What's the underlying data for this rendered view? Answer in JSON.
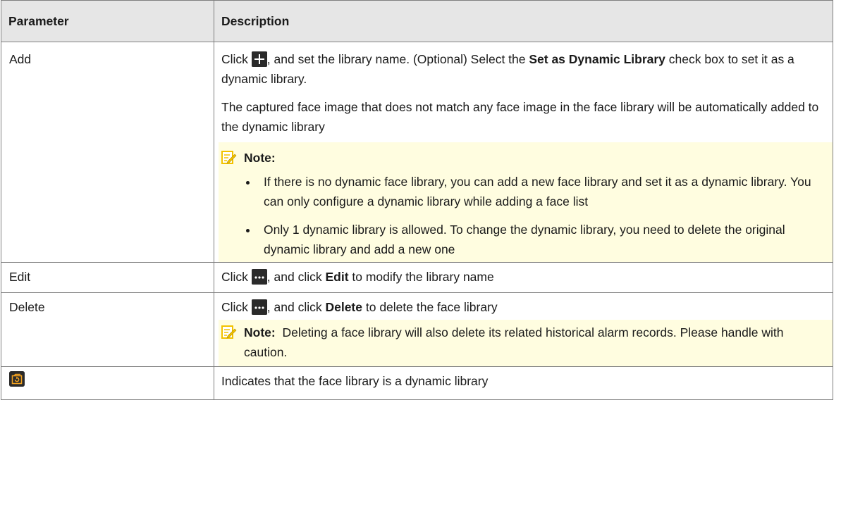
{
  "table": {
    "headers": [
      "Parameter",
      "Description"
    ],
    "rows": {
      "add": {
        "param": "Add",
        "p1_pre": "Click ",
        "p1_mid": ", and set the library name. (Optional) Select the ",
        "p1_bold": "Set as Dynamic Library",
        "p1_post": " check box to set it as a dynamic library.",
        "p2": "The captured face image that does not match any face image in the face library will be automatically added to the dynamic library",
        "note_label": "Note:",
        "note_items": [
          "If there is no dynamic face library, you can add a new face library and set it as a dynamic library. You can only configure a dynamic library while adding a face list",
          "Only 1 dynamic library is allowed. To change the dynamic library, you need to delete the original dynamic library and add a new one"
        ],
        "icon": "plus-icon"
      },
      "edit": {
        "param": "Edit",
        "pre": "Click ",
        "mid": ", and click ",
        "bold": "Edit",
        "post": " to modify the library name",
        "icon": "more-icon"
      },
      "delete": {
        "param": "Delete",
        "pre": "Click ",
        "mid": ", and click ",
        "bold": "Delete",
        "post": " to delete the face library",
        "note_label": "Note:",
        "note_text": "Deleting a face library will also delete its related historical alarm records. Please handle with caution.",
        "icon": "more-icon"
      },
      "dynamic": {
        "icon": "dynamic-library-icon",
        "desc": "Indicates that the face library is a dynamic library"
      }
    }
  },
  "colors": {
    "header_bg": "#e6e6e6",
    "note_bg": "#fffde0",
    "icon_bg": "#2a2a2a",
    "dynamic_icon_accent": "#f0a020",
    "note_icon_accent": "#f2c200"
  }
}
